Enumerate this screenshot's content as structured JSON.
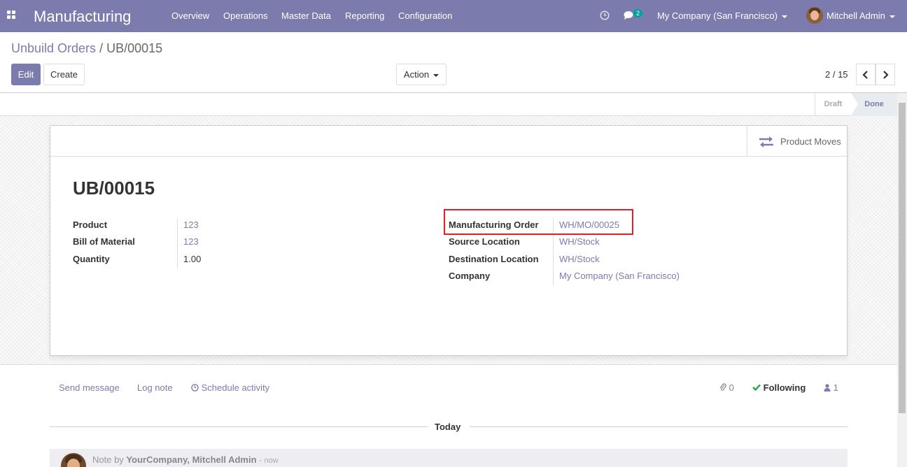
{
  "navbar": {
    "app_title": "Manufacturing",
    "menu": [
      "Overview",
      "Operations",
      "Master Data",
      "Reporting",
      "Configuration"
    ],
    "messages_badge": "2",
    "company": "My Company (San Francisco)",
    "user": "Mitchell Admin"
  },
  "breadcrumb": {
    "parent": "Unbuild Orders",
    "separator": "/",
    "current": "UB/00015"
  },
  "buttons": {
    "edit": "Edit",
    "create": "Create",
    "action": "Action"
  },
  "pager": {
    "value": "2 / 15"
  },
  "statusbar": {
    "draft": "Draft",
    "done": "Done",
    "active": "Done"
  },
  "smart_button": {
    "label": "Product Moves",
    "icon": "exchange-icon"
  },
  "record": {
    "title": "UB/00015",
    "left_fields": [
      {
        "label": "Product",
        "value": "123"
      },
      {
        "label": "Bill of Material",
        "value": "123"
      },
      {
        "label": "Quantity",
        "value": "1.00"
      }
    ],
    "right_fields": [
      {
        "label": "Manufacturing Order",
        "value": "WH/MO/00025"
      },
      {
        "label": "Source Location",
        "value": "WH/Stock"
      },
      {
        "label": "Destination Location",
        "value": "WH/Stock"
      },
      {
        "label": "Company",
        "value": "My Company (San Francisco)"
      }
    ]
  },
  "chatter": {
    "send_message": "Send message",
    "log_note": "Log note",
    "schedule_activity": "Schedule activity",
    "attachments": "0",
    "following": "Following",
    "followers": "1",
    "date_separator": "Today",
    "message": {
      "prefix": "Note by",
      "author": "YourCompany, Mitchell Admin",
      "dash": "-",
      "time": "now"
    }
  },
  "colors": {
    "brand": "#7c7bad",
    "highlight": "#d9232a",
    "following": "#28a745"
  }
}
